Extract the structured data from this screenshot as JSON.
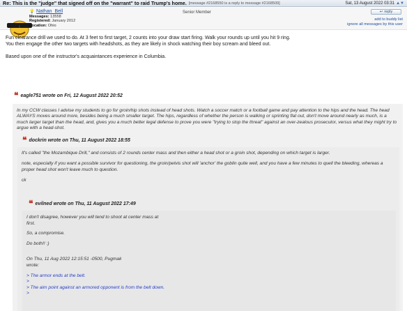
{
  "titlebar": {
    "subject": "Re: This is the \"judge\" that signed off on the \"warrant\" to raid Trump's home.",
    "meta": "[message #2168550 is a reply to message #2168509]",
    "date": "Sat, 13 August 2022 03:31",
    "nav_arrows": "▲▼"
  },
  "author": {
    "name": "Nathan_Bell",
    "rank": "Senior Member",
    "messages_label": "Messages:",
    "messages": "13558",
    "registered_label": "Registered:",
    "registered": "January 2012",
    "location_label": "Location:",
    "location": "Ohio"
  },
  "actions": {
    "reply": "reply",
    "add_buddy": "add to buddy list",
    "ignore": "ignore all messages by this user"
  },
  "post": {
    "para1_line1": "Fun clearance drill we used to do. At 3 feet to first target, 2 counts into your draw start firing. Walk your rounds up until you hit 9 ring.",
    "para1_line2": "You then engage the other two targets with headshots,  as they are likely in shock watching their boy scream and bleed out.",
    "para2": "Based upon one of the instructor's acquaintances experience in Columbia."
  },
  "quote1": {
    "header": "eagle751 wrote on Fri, 12 August 2022 20:52",
    "text": "In my CCW classes I advise my students to go for groin/hip shots instead of head shots.  Watch a soccer match or a football game and pay attention to the hips and the head.  The head ALWAYS moves around more, besides being a much smaller target.  The hips, regardless of whether the person is walking or sprinting flat out, don't move around nearly as much, is a much larger target than the head, and, gives you a much better legal defense to prove you were \"trying to stop the threat\" against an over-zealous prosecutor, versus what they might try to argue with a head-shot."
  },
  "quote2": {
    "header": "dockrin wrote on Thu, 11 August 2022 18:55",
    "para1": "It's called \"the Mozambique Drill,\" and consists of 2 rounds center mass and then either a head shot or a groin shot, depending on which target is larger.",
    "para2": "note, especially if you want a possible survivor for questioning, the groin/pelvis shot will 'anchor' the goblin quite well, and you have a few minutes to quell the bleeding, whereas a proper head shot won't leave much to question.",
    "sig": "ck"
  },
  "quote3": {
    "header": "evilned wrote on Thu, 11 August 2022 17:49",
    "line1": "I don't disagree, however you will tend to shoot at center mass at",
    "line2": "first.",
    "line3": "So, a compromise.",
    "line4": "Do both!! :)",
    "line5": "On Thu, 11 Aug 2022 12:15:51 -0500, Pugmak",
    "line6": "wrote:",
    "q1": "> The armor ends at the belt.",
    "q2": ">",
    "q3": "> The aim point against an armored opponent is from the belt down.",
    "q4": ">"
  }
}
